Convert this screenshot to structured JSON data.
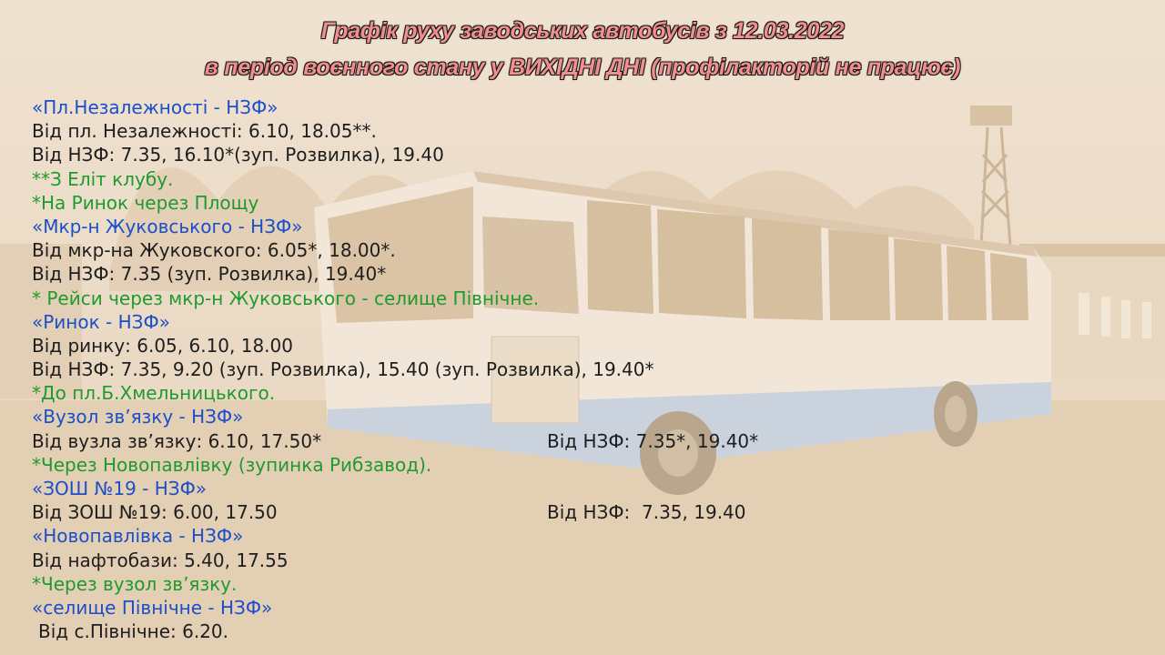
{
  "colors": {
    "title_fill": "#f08f8d",
    "route": "#1a4fc9",
    "note": "#1f9a2e",
    "text": "#1e1e1e",
    "background": "#ead9c2"
  },
  "title": {
    "line1": "Графік руху заводських автобусів з 12.03.2022",
    "line2": "в період воєнного стану у ВИХІДНІ ДНІ (профілакторій не працює)"
  },
  "schedule": [
    {
      "type": "route",
      "text": "«Пл.Незалежності - НЗФ»"
    },
    {
      "type": "time",
      "text": "Від пл. Незалежності: 6.10, 18.05**."
    },
    {
      "type": "time",
      "text": "Від НЗФ: 7.35, 16.10*(зуп. Розвилка), 19.40"
    },
    {
      "type": "note",
      "text": "**З Еліт клубу."
    },
    {
      "type": "note",
      "text": "*На Ринок через Площу"
    },
    {
      "type": "route",
      "text": "«Мкр-н Жуковського - НЗФ»"
    },
    {
      "type": "time",
      "text": "Від мкр-на Жуковского: 6.05*, 18.00*."
    },
    {
      "type": "time",
      "text": "Від НЗФ: 7.35 (зуп. Розвилка), 19.40*"
    },
    {
      "type": "note",
      "text": "* Рейси через мкр-н Жуковського - селище Північне."
    },
    {
      "type": "route",
      "text": "«Ринок - НЗФ»"
    },
    {
      "type": "time",
      "text": "Від ринку: 6.05, 6.10, 18.00"
    },
    {
      "type": "time",
      "text": "Від НЗФ: 7.35, 9.20 (зуп. Розвилка), 15.40 (зуп. Розвилка), 19.40*"
    },
    {
      "type": "note",
      "text": "*До пл.Б.Хмельницького."
    },
    {
      "type": "route",
      "text": "«Вузол зв’язку - НЗФ»"
    },
    {
      "type": "time",
      "text": "Від вузла зв’язку: 6.10, 17.50*",
      "right": "Від НЗФ: 7.35*, 19.40*"
    },
    {
      "type": "note",
      "text": "*Через Новопавлівку (зупинка Рибзавод)."
    },
    {
      "type": "route",
      "text": "«ЗОШ №19 - НЗФ»"
    },
    {
      "type": "time",
      "text": "Від ЗОШ №19: 6.00, 17.50",
      "right": "Від НЗФ:  7.35, 19.40"
    },
    {
      "type": "route",
      "text": "«Новопавлівка - НЗФ»"
    },
    {
      "type": "time",
      "text": "Від нафтобази: 5.40, 17.55"
    },
    {
      "type": "note",
      "text": "*Через вузол зв’язку."
    },
    {
      "type": "route",
      "text": "«селище Північне - НЗФ»"
    },
    {
      "type": "time",
      "text": "Від с.Північне: 6.20.",
      "indent": true
    }
  ]
}
